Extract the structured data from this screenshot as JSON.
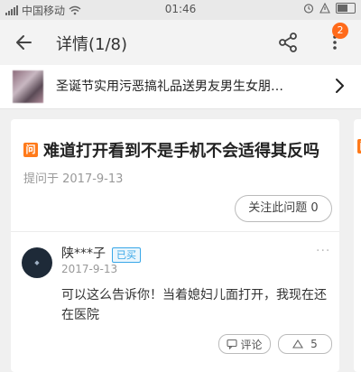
{
  "status_bar": {
    "carrier": "中国移动",
    "time": "01:46"
  },
  "header": {
    "title": "详情(1/8)",
    "badge_count": "2"
  },
  "product": {
    "title": "圣诞节实用污恶搞礼品送男友男生女朋…"
  },
  "question": {
    "title": "难道打开看到不是手机不会适得其反吗",
    "date": "提问于 2017-9-13",
    "follow_label": "关注此问题 0",
    "icon_glyph": "问"
  },
  "answer": {
    "user": "陕***子",
    "badge": "已买",
    "date": "2017-9-13",
    "text": "可以这么告诉你！当着媳妇儿面打开，我现在还在医院",
    "comment_label": "评论",
    "like_count": "5",
    "more": "···"
  },
  "colors": {
    "accent": "#ff7a1a",
    "badge_blue": "#38a7e8"
  }
}
